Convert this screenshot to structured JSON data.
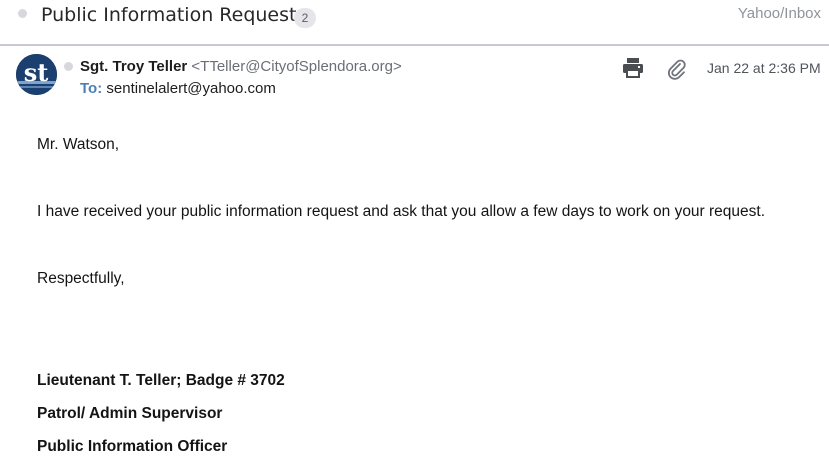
{
  "subject": {
    "title": "Public Information Request",
    "count": "2",
    "folder_path": "Yahoo/Inbox"
  },
  "message": {
    "avatar_initials": "st",
    "sender_name": "Sgt. Troy Teller",
    "sender_email": "<TTeller@CityofSplendora.org>",
    "to_label": "To:",
    "to_value": "sentinelalert@yahoo.com",
    "date": "Jan 22 at 2:36 PM",
    "icons": [
      "print-icon",
      "attachment-icon"
    ]
  },
  "body": {
    "greeting": "Mr. Watson,",
    "paragraph": "I have received your public information request and ask that you allow a few days to work on your request.",
    "closing": "Respectfully,",
    "signature": [
      "Lieutenant T. Teller; Badge # 3702",
      "Patrol/ Admin Supervisor",
      "Public Information Officer"
    ]
  },
  "colors": {
    "accent_blue": "#4b7fb8",
    "avatar_navy": "#1b3f6e",
    "muted_gray": "#8f939b"
  }
}
